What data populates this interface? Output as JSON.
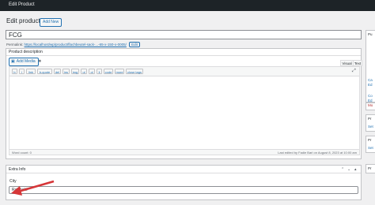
{
  "topbar": {
    "title": "Edit Product"
  },
  "header": {
    "page_title": "Edit product",
    "add_new": "Add New"
  },
  "product": {
    "title": "FCG"
  },
  "permalink": {
    "label": "Permalink:",
    "url": "https://localhost/wp/product/flachbeutel-sack-...-65-x-150-x-0005/",
    "edit": "Edit"
  },
  "description": {
    "heading": "Product description",
    "add_media": "Add Media",
    "tab_visual": "Visual",
    "tab_text": "Text",
    "quicktags": [
      "b",
      "i",
      "link",
      "b-quote",
      "del",
      "ins",
      "img",
      "ul",
      "ol",
      "li",
      "code",
      "more",
      "close tags"
    ],
    "word_count": "Word count: 0",
    "last_edited": "Last edited by Fadie Barl on August 8, 2023 at 10:00 am"
  },
  "extra_info": {
    "heading": "Extra Info",
    "city_label": "City",
    "city_value": "Rajshahi"
  },
  "sidebar": {
    "items": [
      "Pu",
      "Ca",
      "Ed",
      "Co",
      "Ed",
      "Mo",
      "Pr",
      "Set",
      "Pr",
      "Set",
      "Pr"
    ]
  },
  "colors": {
    "accent": "#2271b1",
    "arrow": "#d63638",
    "adminbar": "#1d2327"
  }
}
